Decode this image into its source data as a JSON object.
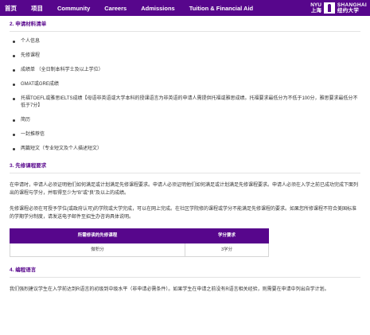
{
  "nav": {
    "items": [
      "首页",
      "项目",
      "Community",
      "Careers",
      "Admissions",
      "Tuition & Financial Aid"
    ],
    "logo": {
      "nyu": "NYU",
      "city_cn": "上海",
      "shanghai": "SHANGHAI",
      "name_cn": "纽约大学"
    }
  },
  "section2": {
    "title": "2. 申请材料清单",
    "items": [
      "个人信息",
      "先修课程",
      "成绩单 （全日制本科学士及以上学位）",
      "GMAT或GRE成绩",
      "托福TOEFL或雅思IELTS成绩【母语非英语或大学本科的授课语言为非英语的申请人需提供托福或雅思成绩。托福要求最低分为不低于100分，雅思要求最低分不低于7分】",
      "简历",
      "一封推荐信",
      "两篇短文（专业短文及个人描述短文）"
    ]
  },
  "section3": {
    "title": "3. 先修课程要求",
    "para1": "在申请时，申请人必须证明他们如何满足或计划满足先修课程要求。申请人必须证明他们如何满足或计划满足先修课程要求。申请人必须在入学之前已成功完成下面列出的课程与学分，并取得至少为“B”或“良”及以上的成绩。",
    "para2": "先修课程必须在可授予学位(或政府认可)的学院或大学完成，可以在网上完成。在社区学院修的课程或学分不能满足先修课程的要求。如果您所修课程不符合美国标准的学期学分制度，请发送电子邮件至招生办咨询具体说明。",
    "table": {
      "headers": [
        "所需修读的先修课程",
        "学分要求"
      ],
      "rows": [
        [
          "微积分",
          "3学分"
        ]
      ]
    }
  },
  "section4": {
    "title": "4. 编程语言",
    "para": "我们强烈建议学生在入学前达到R语言的初级到中级水平（非申请必需条件）。如果学生在申请之前没有R语言相关经验，则需要在申请中列出自学计划。"
  },
  "colors": {
    "brand": "#57068c"
  }
}
